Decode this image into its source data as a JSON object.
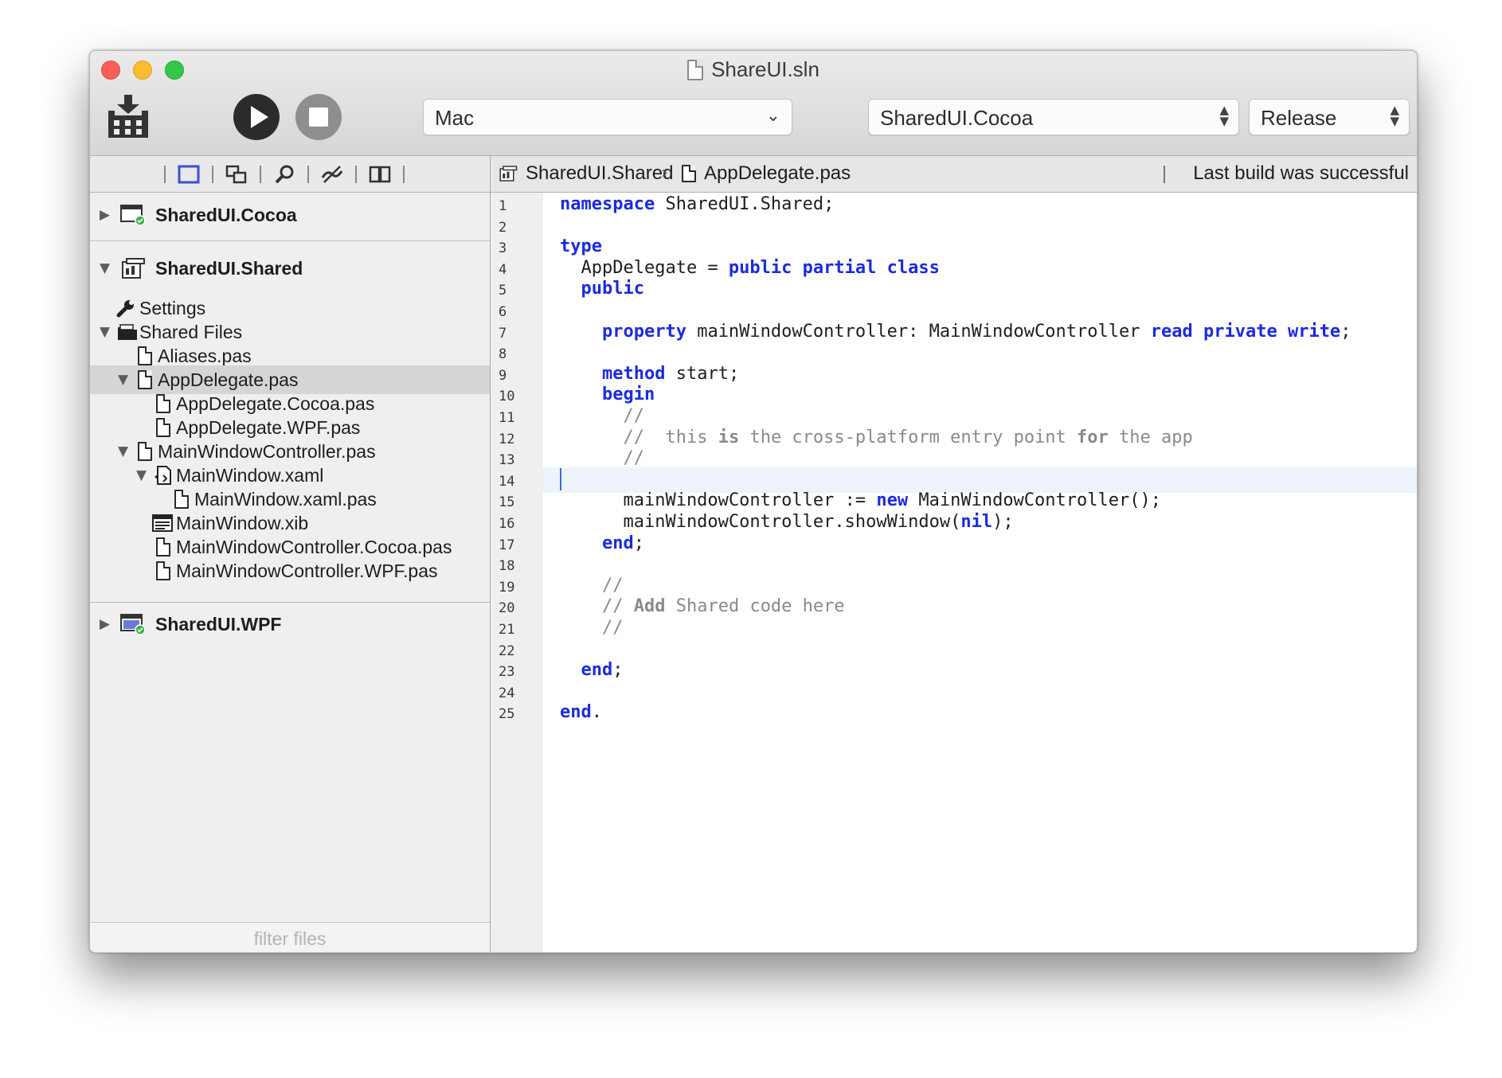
{
  "window": {
    "title": "ShareUI.sln"
  },
  "toolbar": {
    "destination": "Mac",
    "project": "SharedUI.Cocoa",
    "configuration": "Release"
  },
  "sidebar": {
    "tools": [
      "projects-icon",
      "classes-icon",
      "search-icon",
      "compare-icon",
      "book-icon"
    ],
    "filter_placeholder": "filter files",
    "tree": {
      "cocoa": "SharedUI.Cocoa",
      "shared": "SharedUI.Shared",
      "settings": "Settings",
      "shared_files": "Shared Files",
      "aliases": "Aliases.pas",
      "appdelegate": "AppDelegate.pas",
      "appdelegate_cocoa": "AppDelegate.Cocoa.pas",
      "appdelegate_wpf": "AppDelegate.WPF.pas",
      "mainwindowcontroller": "MainWindowController.pas",
      "mainwindow_xaml": "MainWindow.xaml",
      "mainwindow_xaml_pas": "MainWindow.xaml.pas",
      "mainwindow_xib": "MainWindow.xib",
      "mwc_cocoa": "MainWindowController.Cocoa.pas",
      "mwc_wpf": "MainWindowController.WPF.pas",
      "wpf": "SharedUI.WPF"
    }
  },
  "jumpbar": {
    "project": "SharedUI.Shared",
    "file": "AppDelegate.pas",
    "status": "Last build was successful"
  },
  "code": {
    "current_line": 14,
    "lines": [
      [
        [
          "kw",
          "namespace"
        ],
        [
          "t",
          " SharedUI.Shared;"
        ]
      ],
      [],
      [
        [
          "kw",
          "type"
        ]
      ],
      [
        [
          "t",
          "  AppDelegate = "
        ],
        [
          "kw",
          "public"
        ],
        [
          "t",
          " "
        ],
        [
          "kw",
          "partial"
        ],
        [
          "t",
          " "
        ],
        [
          "kw",
          "class"
        ]
      ],
      [
        [
          "t",
          "  "
        ],
        [
          "kw",
          "public"
        ]
      ],
      [],
      [
        [
          "t",
          "    "
        ],
        [
          "kw",
          "property"
        ],
        [
          "t",
          " mainWindowController: MainWindowController "
        ],
        [
          "kw",
          "read"
        ],
        [
          "t",
          " "
        ],
        [
          "kw",
          "private"
        ],
        [
          "t",
          " "
        ],
        [
          "kw",
          "write"
        ],
        [
          "t",
          ";"
        ]
      ],
      [],
      [
        [
          "t",
          "    "
        ],
        [
          "kw",
          "method"
        ],
        [
          "t",
          " start;"
        ]
      ],
      [
        [
          "t",
          "    "
        ],
        [
          "kw",
          "begin"
        ]
      ],
      [
        [
          "t",
          "      "
        ],
        [
          "cm",
          "//"
        ]
      ],
      [
        [
          "t",
          "      "
        ],
        [
          "cm",
          "//  this "
        ],
        [
          "cmb",
          "is"
        ],
        [
          "cm",
          " the cross-platform entry point "
        ],
        [
          "cmb",
          "for"
        ],
        [
          "cm",
          " the app"
        ]
      ],
      [
        [
          "t",
          "      "
        ],
        [
          "cm",
          "//"
        ]
      ],
      [
        [
          "caret",
          ""
        ]
      ],
      [
        [
          "t",
          "      mainWindowController := "
        ],
        [
          "kw",
          "new"
        ],
        [
          "t",
          " MainWindowController();"
        ]
      ],
      [
        [
          "t",
          "      mainWindowController.showWindow("
        ],
        [
          "kw",
          "nil"
        ],
        [
          "t",
          ");"
        ]
      ],
      [
        [
          "t",
          "    "
        ],
        [
          "kw",
          "end"
        ],
        [
          "t",
          ";"
        ]
      ],
      [],
      [
        [
          "t",
          "    "
        ],
        [
          "cm",
          "//"
        ]
      ],
      [
        [
          "t",
          "    "
        ],
        [
          "cm",
          "// "
        ],
        [
          "cmb",
          "Add"
        ],
        [
          "cm",
          " Shared code here"
        ]
      ],
      [
        [
          "t",
          "    "
        ],
        [
          "cm",
          "//"
        ]
      ],
      [],
      [
        [
          "t",
          "  "
        ],
        [
          "kw",
          "end"
        ],
        [
          "t",
          ";"
        ]
      ],
      [],
      [
        [
          "kw",
          "end"
        ],
        [
          "t",
          "."
        ]
      ]
    ]
  }
}
